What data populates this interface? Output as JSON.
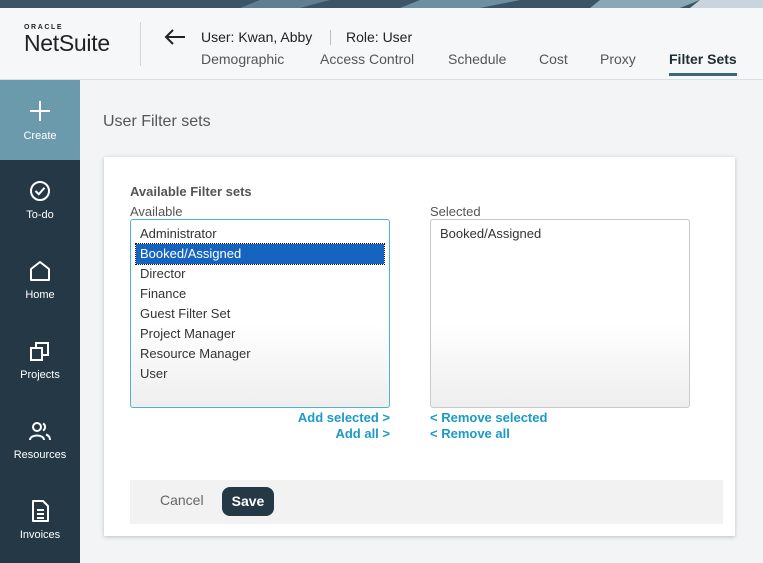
{
  "brand": {
    "oracle": "ORACLE",
    "netsuite": "NetSuite"
  },
  "header": {
    "user": "User: Kwan, Abby",
    "role": "Role: User",
    "tabs": [
      {
        "label": "Demographic"
      },
      {
        "label": "Access Control"
      },
      {
        "label": "Schedule"
      },
      {
        "label": "Cost"
      },
      {
        "label": "Proxy"
      },
      {
        "label": "Filter Sets",
        "active": true
      }
    ]
  },
  "sidebar": {
    "items": [
      {
        "label": "Create",
        "icon": "plus-icon"
      },
      {
        "label": "To-do",
        "icon": "check-circle-icon"
      },
      {
        "label": "Home",
        "icon": "home-icon"
      },
      {
        "label": "Projects",
        "icon": "projects-icon"
      },
      {
        "label": "Resources",
        "icon": "users-icon"
      },
      {
        "label": "Invoices",
        "icon": "invoice-icon"
      }
    ]
  },
  "main": {
    "title": "User Filter sets",
    "section_title": "Available Filter sets",
    "available_label": "Available",
    "selected_label": "Selected",
    "available": [
      "Administrator",
      "Booked/Assigned",
      "Director",
      "Finance",
      "Guest Filter Set",
      "Project Manager",
      "Resource Manager",
      "User"
    ],
    "highlighted_available": "Booked/Assigned",
    "selected": [
      "Booked/Assigned"
    ],
    "add_selected": "Add selected >",
    "add_all": "Add all >",
    "remove_selected": "< Remove selected",
    "remove_all": "< Remove all",
    "cancel": "Cancel",
    "save": "Save"
  },
  "colors": {
    "sidebar": "#243846",
    "create_active": "#6c9aad",
    "link": "#1a9bc7",
    "highlight": "#1565c0",
    "tab_underline": "#36677d"
  }
}
